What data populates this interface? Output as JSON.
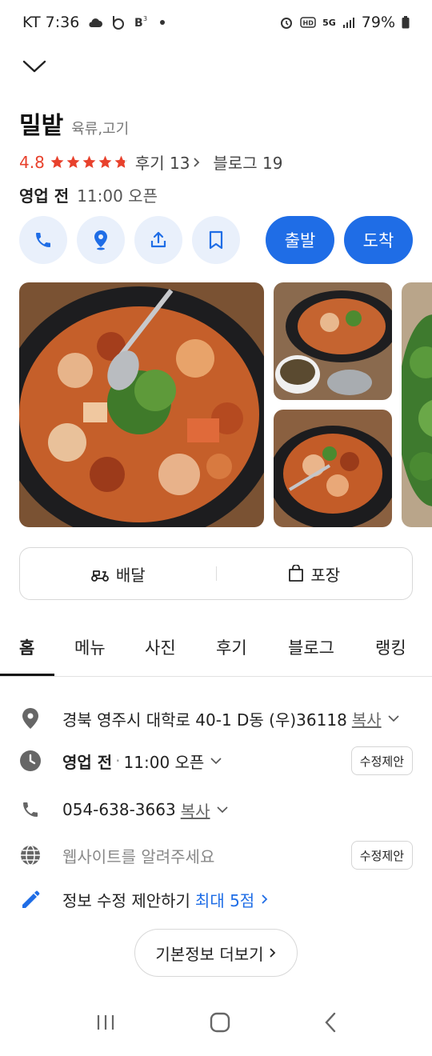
{
  "status_bar": {
    "carrier_time": "KT 7:36",
    "battery": "79%",
    "network": "5G"
  },
  "place": {
    "name": "밀밭",
    "category": "육류,고기",
    "rating": "4.8",
    "rating_stars": 4.8,
    "review_label": "후기 13",
    "blog_label": "블로그 19",
    "hours_status": "영업 전",
    "hours_open": "11:00 오픈"
  },
  "actions": {
    "icons": [
      "phone-icon",
      "map-pin-icon",
      "share-icon",
      "bookmark-icon"
    ],
    "departure_label": "출발",
    "arrival_label": "도착"
  },
  "order": {
    "delivery_label": "배달",
    "takeout_label": "포장"
  },
  "tabs": [
    "홈",
    "메뉴",
    "사진",
    "후기",
    "블로그",
    "랭킹"
  ],
  "info": {
    "address": "경북 영주시 대학로 40-1 D동 (우)36118",
    "copy_label": "복사",
    "hours_status": "영업 전",
    "hours_sep": "·",
    "hours_open": "11:00 오픈",
    "suggest_label": "수정제안",
    "phone": "054-638-3663",
    "website_placeholder": "웹사이트를 알려주세요",
    "edit_suggest": "정보 수정 제안하기",
    "edit_max": "최대 5점",
    "more_label": "기본정보 더보기"
  },
  "colors": {
    "accent": "#1f6de6",
    "rating": "#e8412c",
    "circle_bg": "#e9f0fb"
  }
}
